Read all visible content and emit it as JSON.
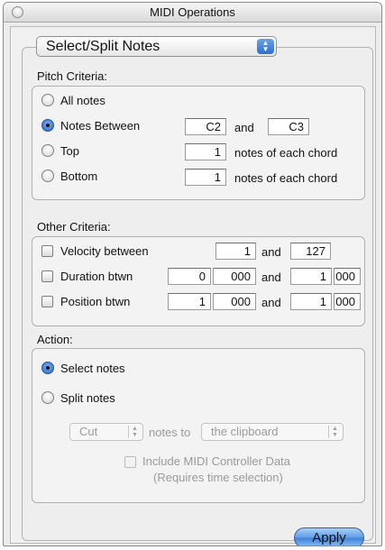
{
  "window": {
    "title": "MIDI Operations"
  },
  "operation": {
    "selected": "Select/Split Notes"
  },
  "pitch": {
    "label": "Pitch Criteria:",
    "all_notes": "All notes",
    "notes_between": "Notes Between",
    "from": "C2",
    "and": "and",
    "to": "C3",
    "top": "Top",
    "top_value": "1",
    "bottom": "Bottom",
    "bottom_value": "1",
    "notes_of_each_chord": "notes of each chord",
    "selected_option": "notes_between"
  },
  "other": {
    "label": "Other Criteria:",
    "velocity": {
      "label": "Velocity between",
      "from": "1",
      "and": "and",
      "to": "127"
    },
    "duration": {
      "label": "Duration btwn",
      "from_a": "0",
      "from_b": "000",
      "and": "and",
      "to_a": "1",
      "to_b": "000"
    },
    "position": {
      "label": "Position btwn",
      "from_a": "1",
      "from_b": "000",
      "and": "and",
      "to_a": "1",
      "to_b": "000"
    }
  },
  "action": {
    "label": "Action:",
    "select_notes": "Select notes",
    "split_notes": "Split notes",
    "selected_option": "select_notes",
    "cut_value": "Cut",
    "notes_to": "notes to",
    "destination": "the clipboard",
    "include_midi": "Include MIDI Controller Data",
    "requires": "(Requires time selection)"
  },
  "apply_label": "Apply",
  "colors": {
    "accent": "#3f7fd9",
    "window_bg": "#ececec"
  }
}
